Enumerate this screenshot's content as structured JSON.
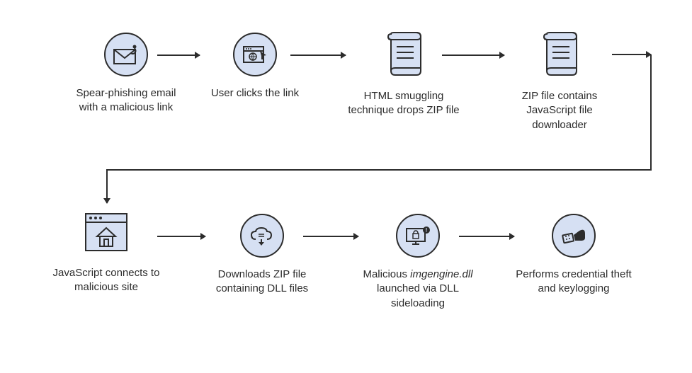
{
  "steps": {
    "s1": {
      "label": "Spear-phishing email with a malicious link",
      "name": "phishing-email"
    },
    "s2": {
      "label": "User clicks the link",
      "name": "user-clicks-link"
    },
    "s3": {
      "label": "HTML smuggling technique drops ZIP file",
      "name": "html-smuggling"
    },
    "s4": {
      "label": "ZIP file contains JavaScript file downloader",
      "name": "zip-js-downloader"
    },
    "s5": {
      "label": "JavaScript connects to malicious site",
      "name": "js-connects-site"
    },
    "s6": {
      "label": "Downloads ZIP file containing DLL files",
      "name": "download-dll"
    },
    "s7": {
      "label_pre": "Malicious ",
      "label_em": "imgengine.dll",
      "label_post": " launched via DLL sideloading",
      "name": "dll-sideloading"
    },
    "s8": {
      "label": "Performs credential theft and keylogging",
      "name": "credential-theft"
    }
  }
}
